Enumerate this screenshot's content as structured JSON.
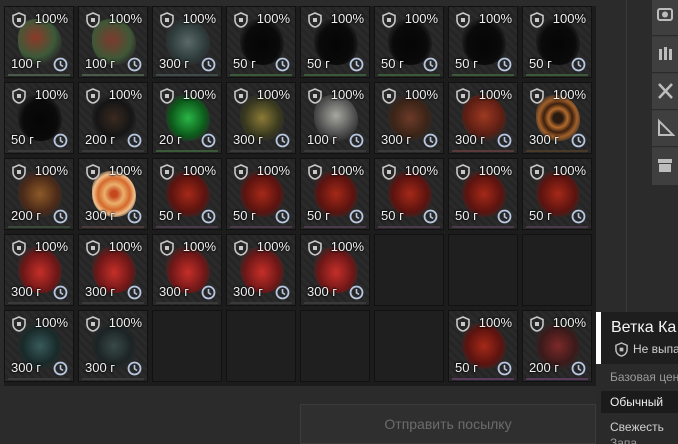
{
  "inventory": {
    "slots": [
      [
        {
          "state": "100%",
          "weight": "100 г",
          "art": "radial-gradient(circle at 40% 40%, #8a3a2a, #3e5a3a 50%, #2a2a2a 75%)",
          "under": "#4a5a4a"
        },
        {
          "state": "100%",
          "weight": "100 г",
          "art": "radial-gradient(circle at 45% 45%, #7a3a2e, #405838 55%, #2a2a2a 78%)",
          "under": "#4a5a4a"
        },
        {
          "state": "100%",
          "weight": "300 г",
          "art": "radial-gradient(circle at 50% 50%, #5a6a68, #2f3c3c 55%, #2a2a2a 78%)",
          "under": "#3f4a4a"
        },
        {
          "state": "100%",
          "weight": "50 г",
          "art": "radial-gradient(ellipse at 50% 55%, #050505, #0a0a0a 55%, #2a2a2a 80%)",
          "under": "#3a5a3a"
        },
        {
          "state": "100%",
          "weight": "50 г",
          "art": "radial-gradient(ellipse at 50% 55%, #050505, #0a0a0a 55%, #2a2a2a 80%)",
          "under": "#3a5a3a"
        },
        {
          "state": "100%",
          "weight": "50 г",
          "art": "radial-gradient(ellipse at 50% 55%, #050505, #0a0a0a 55%, #2a2a2a 80%)",
          "under": "#3a5a3a"
        },
        {
          "state": "100%",
          "weight": "50 г",
          "art": "radial-gradient(ellipse at 50% 55%, #050505, #0a0a0a 55%, #2a2a2a 80%)",
          "under": "#3a5a3a"
        },
        {
          "state": "100%",
          "weight": "50 г",
          "art": "radial-gradient(ellipse at 50% 55%, #050505, #0a0a0a 55%, #2a2a2a 80%)",
          "under": "#3a5a3a"
        }
      ],
      [
        {
          "state": "100%",
          "weight": "50 г",
          "art": "radial-gradient(ellipse at 50% 55%, #050505, #0a0a0a 55%, #2a2a2a 80%)",
          "under": "#3a3a3a"
        },
        {
          "state": "100%",
          "weight": "200 г",
          "art": "radial-gradient(circle at 50% 50%, #3a2a20, #151515 55%, #2a2a2a 80%)",
          "under": "#3a3a3a"
        },
        {
          "state": "100%",
          "weight": "20 г",
          "art": "radial-gradient(ellipse at 50% 50%, #2fb34a, #0f5a1c 55%, #2a2a2a 80%)",
          "under": "#3a5a3a"
        },
        {
          "state": "100%",
          "weight": "300 г",
          "art": "radial-gradient(circle at 50% 50%, #8a7a3a, #3a3a20 55%, #2a2a2a 80%)",
          "under": "#3a3a3a"
        },
        {
          "state": "100%",
          "weight": "100 г",
          "art": "radial-gradient(circle at 50% 45%, #a8a8a0, #505050 55%, #2a2a2a 80%)",
          "under": "#3a3a3a"
        },
        {
          "state": "100%",
          "weight": "300 г",
          "art": "radial-gradient(circle at 50% 50%, #6a3a2a, #3a2418 55%, #2a2a2a 80%)",
          "under": "#3a3a3a"
        },
        {
          "state": "100%",
          "weight": "300 г",
          "art": "radial-gradient(circle at 50% 45%, #9a3a24, #5a1f14 55%, #2a2a2a 80%)",
          "under": "#5a3a3a"
        },
        {
          "state": "100%",
          "weight": "300 г",
          "art": "radial-gradient(circle at 50% 50%, #2a1a10 15%, #b06a30 30%, #3a2010 45%, #a0602c 60%, #2a2a2a 80%)",
          "under": "#4a3a2a"
        }
      ],
      [
        {
          "state": "100%",
          "weight": "200 г",
          "art": "radial-gradient(circle at 50% 50%, #8a5a2a, #4a2a1a 55%, #2a2a2a 80%)",
          "under": "#3a4a3a"
        },
        {
          "state": "100%",
          "weight": "300 г",
          "art": "radial-gradient(circle at 50% 50%, #c04a20 10%, #e8b070 30%, #d06a30 50%, #f0c090 65%, #2a2a2a 82%)",
          "under": "#4a3a3a"
        },
        {
          "state": "100%",
          "weight": "50 г",
          "art": "radial-gradient(ellipse at 50% 50%, #a02a1a, #5a1410 55%, #2a2a2a 80%)",
          "under": "#4a3a4a"
        },
        {
          "state": "100%",
          "weight": "50 г",
          "art": "radial-gradient(ellipse at 50% 50%, #a02a1a, #5a1410 55%, #2a2a2a 80%)",
          "under": "#4a3a4a"
        },
        {
          "state": "100%",
          "weight": "50 г",
          "art": "radial-gradient(ellipse at 50% 50%, #a02a1a, #5a1410 55%, #2a2a2a 80%)",
          "under": "#4a3a4a"
        },
        {
          "state": "100%",
          "weight": "50 г",
          "art": "radial-gradient(ellipse at 50% 50%, #a02a1a, #5a1410 55%, #2a2a2a 80%)",
          "under": "#4a3a4a"
        },
        {
          "state": "100%",
          "weight": "50 г",
          "art": "radial-gradient(ellipse at 50% 50%, #a02a1a, #5a1410 55%, #2a2a2a 80%)",
          "under": "#4a3a4a"
        },
        {
          "state": "100%",
          "weight": "50 г",
          "art": "radial-gradient(ellipse at 50% 50%, #a02a1a, #5a1410 55%, #2a2a2a 80%)",
          "under": "#4a3a4a"
        }
      ],
      [
        {
          "state": "100%",
          "weight": "300 г",
          "art": "radial-gradient(ellipse at 50% 55%, #c0302a, #6a1818 55%, #2a2a2a 80%)",
          "under": "#3a3a3a"
        },
        {
          "state": "100%",
          "weight": "300 г",
          "art": "radial-gradient(ellipse at 50% 55%, #c0302a, #6a1818 55%, #2a2a2a 80%)",
          "under": "#3a3a3a"
        },
        {
          "state": "100%",
          "weight": "300 г",
          "art": "radial-gradient(ellipse at 50% 55%, #c0302a, #6a1818 55%, #2a2a2a 80%)",
          "under": "#3a3a3a"
        },
        {
          "state": "100%",
          "weight": "300 г",
          "art": "radial-gradient(ellipse at 50% 55%, #c0302a, #6a1818 55%, #2a2a2a 80%)",
          "under": "#3a3a3a"
        },
        {
          "state": "100%",
          "weight": "300 г",
          "art": "radial-gradient(ellipse at 50% 55%, #c0302a, #6a1818 55%, #2a2a2a 80%)",
          "under": "#3a3a3a"
        },
        null,
        null,
        null
      ],
      [
        {
          "state": "100%",
          "weight": "300 г",
          "art": "radial-gradient(circle at 50% 50%, #3a5a5a, #1a2a2a 55%, #2a2a2a 80%)",
          "under": "#3a3a3a"
        },
        {
          "state": "100%",
          "weight": "300 г",
          "art": "radial-gradient(circle at 50% 50%, #3a4a48, #1c2424 55%, #2a2a2a 80%)",
          "under": "#3a3a3a"
        },
        null,
        null,
        null,
        null,
        {
          "state": "100%",
          "weight": "50 г",
          "art": "radial-gradient(ellipse at 50% 50%, #a02a1a, #5a1410 55%, #2a2a2a 80%)",
          "under": "#5a3a5a"
        },
        {
          "state": "100%",
          "weight": "200 г",
          "art": "radial-gradient(circle at 50% 50%, #7a2a2a, #3a1a1a 55%, #2a2a2a 80%)",
          "under": "#5a3a5a"
        }
      ]
    ]
  },
  "send_button": {
    "label": "Отправить посылку"
  },
  "toolbar": {
    "icons": [
      "camera-icon",
      "ammo-icon",
      "tools-icon",
      "ruler-icon",
      "archive-icon"
    ]
  },
  "tooltip": {
    "title": "Ветка Ка",
    "subtitle": "Не выпа",
    "base_price_label": "Базовая цен",
    "rarity": "Обычный",
    "freshness_label": "Свежесть",
    "extra_label": "Запа"
  }
}
